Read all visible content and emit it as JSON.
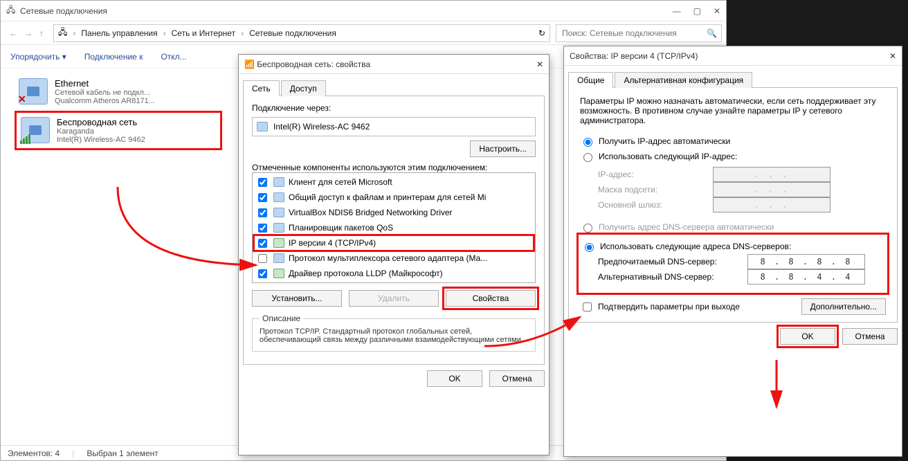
{
  "explorer": {
    "title": "Сетевые подключения",
    "path": [
      "Панель управления",
      "Сеть и Интернет",
      "Сетевые подключения"
    ],
    "refresh": "↻",
    "search_placeholder": "Поиск: Сетевые подключения",
    "toolbar": {
      "organize": "Упорядочить ▾",
      "connect": "Подключение к",
      "disable": "Откл..."
    },
    "connections": [
      {
        "name": "Ethernet",
        "line1": "Сетевой кабель не подкл...",
        "line2": "Qualcomm Atheros AR8171..."
      },
      {
        "name": "Беспроводная сеть",
        "line1": "Karaganda",
        "line2": "Intel(R) Wireless-AC 9462"
      }
    ],
    "status": {
      "count": "Элементов: 4",
      "selected": "Выбран 1 элемент"
    }
  },
  "props": {
    "title": "Беспроводная сеть: свойства",
    "tabs": {
      "net": "Сеть",
      "share": "Доступ"
    },
    "connect_via": "Подключение через:",
    "adapter": "Intel(R) Wireless-AC 9462",
    "configure": "Настроить...",
    "comps_label": "Отмеченные компоненты используются этим подключением:",
    "components": [
      "Клиент для сетей Microsoft",
      "Общий доступ к файлам и принтерам для сетей Mi",
      "VirtualBox NDIS6 Bridged Networking Driver",
      "Планировщик пакетов QoS",
      "IP версии 4 (TCP/IPv4)",
      "Протокол мультиплексора сетевого адаптера (Ма...",
      "Драйвер протокола LLDP (Майкрософт)"
    ],
    "btn_install": "Установить...",
    "btn_remove": "Удалить",
    "btn_props": "Свойства",
    "desc_label": "Описание",
    "desc_text": "Протокол TCP/IP. Стандартный протокол глобальных сетей, обеспечивающий связь между различными взаимодействующими сетями.",
    "ok": "OK",
    "cancel": "Отмена"
  },
  "ipv4": {
    "title": "Свойства: IP версии 4 (TCP/IPv4)",
    "tabs": {
      "general": "Общие",
      "alt": "Альтернативная конфигурация"
    },
    "intro": "Параметры IP можно назначать автоматически, если сеть поддерживает эту возможность. В противном случае узнайте параметры IP у сетевого администратора.",
    "ip_auto": "Получить IP-адрес автоматически",
    "ip_manual": "Использовать следующий IP-адрес:",
    "ip_addr": "IP-адрес:",
    "mask": "Маска подсети:",
    "gateway": "Основной шлюз:",
    "dot_blank": " .      .      . ",
    "dns_auto": "Получить адрес DNS-сервера автоматически",
    "dns_manual": "Использовать следующие адреса DNS-серверов:",
    "pref_dns": "Предпочитаемый DNS-сервер:",
    "alt_dns": "Альтернативный DNS-сервер:",
    "dns1": "8  .  8  .  8  .  8",
    "dns2": "8  .  8  .  4  .  4",
    "confirm": "Подтвердить параметры при выходе",
    "advanced": "Дополнительно...",
    "ok": "OK",
    "cancel": "Отмена"
  }
}
